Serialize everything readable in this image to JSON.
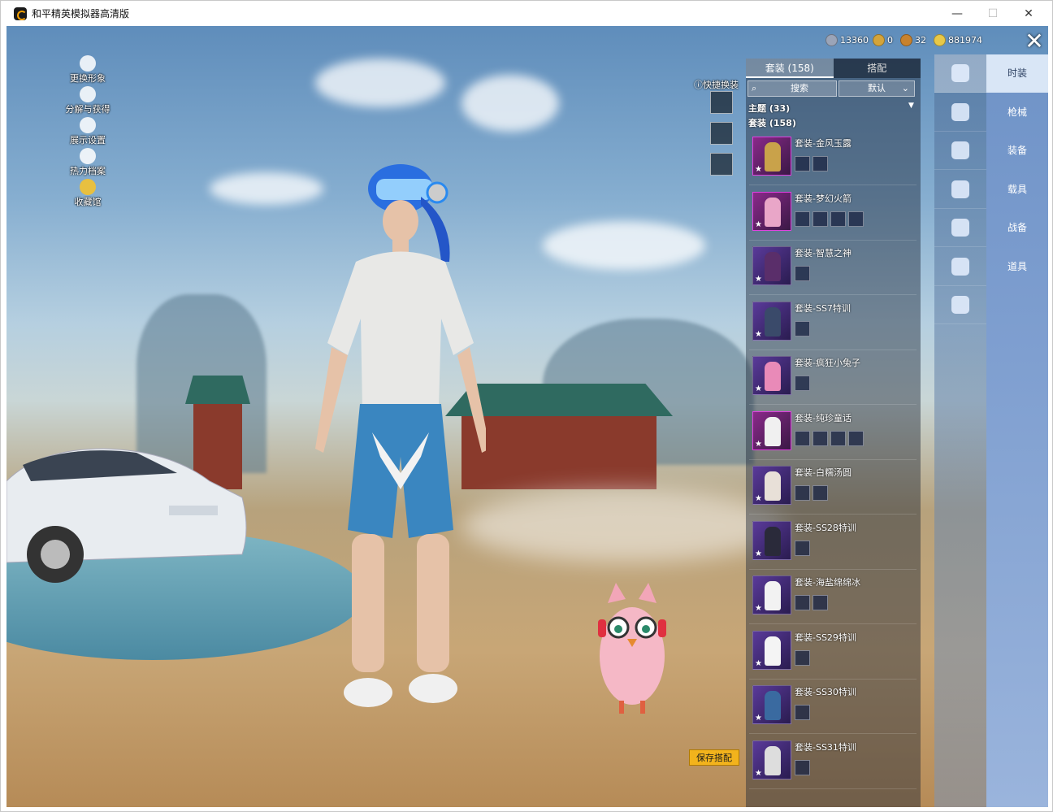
{
  "window": {
    "title": "和平精英模拟器高清版",
    "minimize_icon": "minimize-icon",
    "maximize_icon": "maximize-icon",
    "close_icon": "close-icon"
  },
  "left_tools": [
    {
      "label": "更换形象",
      "icon": "person-icon"
    },
    {
      "label": "分解与获得",
      "icon": "puzzle-icon"
    },
    {
      "label": "展示设置",
      "icon": "eye-icon"
    },
    {
      "label": "热力档案",
      "icon": "flame-icon"
    },
    {
      "label": "收藏馆",
      "icon": "trophy-icon"
    }
  ],
  "currencies": [
    {
      "value": "13360",
      "color": "#9aa4b8"
    },
    {
      "value": "0",
      "color": "#d4a43a"
    },
    {
      "value": "32",
      "color": "#c8822e"
    },
    {
      "value": "881974",
      "color": "#e8c847"
    }
  ],
  "quick_change": {
    "label": "快捷换装",
    "help_icon": "question-icon"
  },
  "panel": {
    "tabs": [
      {
        "label": "套装 (158)"
      },
      {
        "label": "搭配"
      }
    ],
    "search_placeholder": "搜索",
    "sort_value": "默认",
    "categories": [
      "主题 (33)",
      "套装 (158)"
    ]
  },
  "items": [
    {
      "name": "套装-金风玉露",
      "parts": 2,
      "color": "#c9a24a",
      "frame": "pink"
    },
    {
      "name": "套装-梦幻火箭",
      "parts": 4,
      "color": "#e9a6c8",
      "frame": "pink"
    },
    {
      "name": "套装-智慧之神",
      "parts": 1,
      "color": "#5a2e6a",
      "frame": "violet"
    },
    {
      "name": "套装-SS7特训",
      "parts": 1,
      "color": "#3a4a6a",
      "frame": "violet"
    },
    {
      "name": "套装-疯狂小兔子",
      "parts": 1,
      "color": "#e98ab8",
      "frame": "violet"
    },
    {
      "name": "套装-纯珍童话",
      "parts": 4,
      "color": "#f0f0f0",
      "frame": "pink"
    },
    {
      "name": "套装-白糯汤圆",
      "parts": 2,
      "color": "#e8e0d8",
      "frame": "violet"
    },
    {
      "name": "套装-SS28特训",
      "parts": 1,
      "color": "#2a2a3a",
      "frame": "violet"
    },
    {
      "name": "套装-海盐绵绵冰",
      "parts": 2,
      "color": "#f2f2f2",
      "frame": "violet"
    },
    {
      "name": "套装-SS29特训",
      "parts": 1,
      "color": "#f4f4f4",
      "frame": "violet"
    },
    {
      "name": "套装-SS30特训",
      "parts": 1,
      "color": "#3a6aa0",
      "frame": "violet"
    },
    {
      "name": "套装-SS31特训",
      "parts": 1,
      "color": "#dddddd",
      "frame": "violet"
    }
  ],
  "rail": [
    {
      "label": "时装",
      "icon": "hanger-icon"
    },
    {
      "label": "枪械",
      "icon": "gun-skin-icon"
    },
    {
      "label": "装备",
      "icon": "backpack-icon"
    },
    {
      "label": "载具",
      "icon": "helmet-icon"
    },
    {
      "label": "战备",
      "icon": "jacket-icon"
    },
    {
      "label": "道具",
      "icon": "parachute-icon"
    },
    {
      "label": "",
      "icon": "shoes-icon"
    }
  ],
  "save_button": "保存搭配"
}
